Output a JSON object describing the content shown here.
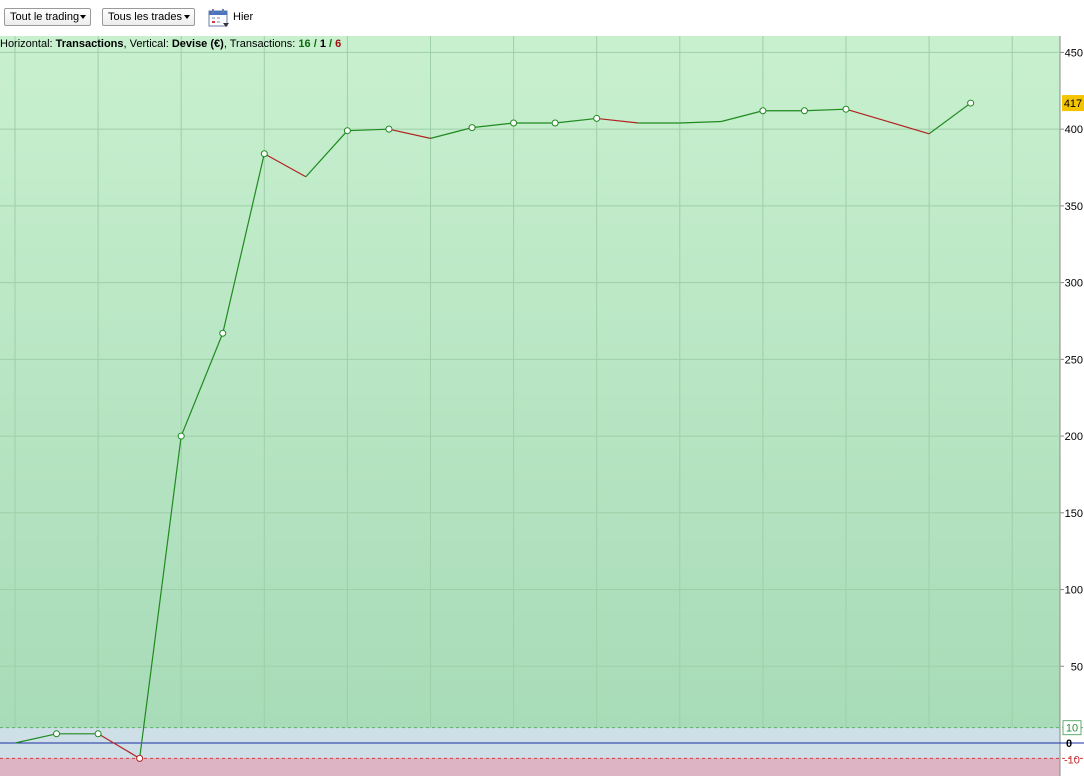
{
  "toolbar": {
    "filter1": "Tout le trading",
    "filter2": "Tous les trades",
    "date_label": "Hier",
    "calendar_icon": "calendar-icon"
  },
  "info": {
    "horizontal_label": "Horizontal:",
    "horizontal_value": "Transactions",
    "vertical_label": "Vertical:",
    "vertical_value": "Devise (€)",
    "transactions_label": "Transactions:",
    "wins": "16",
    "sep1": "/",
    "even": "1",
    "sep2": "/",
    "losses": "6"
  },
  "colors": {
    "up": "#1f8a1f",
    "down": "#b22222",
    "current_badge": "#f5c400",
    "zero_line": "#1a2fa0"
  },
  "chart_data": {
    "type": "line",
    "title": "",
    "xlabel": "Transactions",
    "ylabel": "Devise (€)",
    "x": [
      0,
      1,
      2,
      3,
      4,
      5,
      6,
      7,
      8,
      9,
      10,
      11,
      12,
      13,
      14,
      15,
      16,
      17,
      18,
      19,
      20,
      21,
      22,
      23
    ],
    "values": [
      0,
      6,
      6,
      -10,
      200,
      267,
      384,
      369,
      399,
      400,
      394,
      401,
      404,
      404,
      407,
      404,
      404,
      405,
      412,
      412,
      413,
      405,
      397,
      417
    ],
    "markers": [
      false,
      true,
      true,
      true,
      true,
      true,
      true,
      false,
      true,
      true,
      false,
      true,
      true,
      true,
      true,
      false,
      false,
      false,
      true,
      true,
      true,
      false,
      false,
      true
    ],
    "ylim": [
      -20,
      455
    ],
    "yticks": [
      50,
      100,
      150,
      200,
      250,
      300,
      350,
      400,
      450
    ],
    "band": {
      "upper": 10,
      "zero": 0,
      "lower": -10
    },
    "band_labels": {
      "upper": "10",
      "zero": "0",
      "lower": "-10"
    },
    "current_value_label": "417",
    "grid": true
  }
}
